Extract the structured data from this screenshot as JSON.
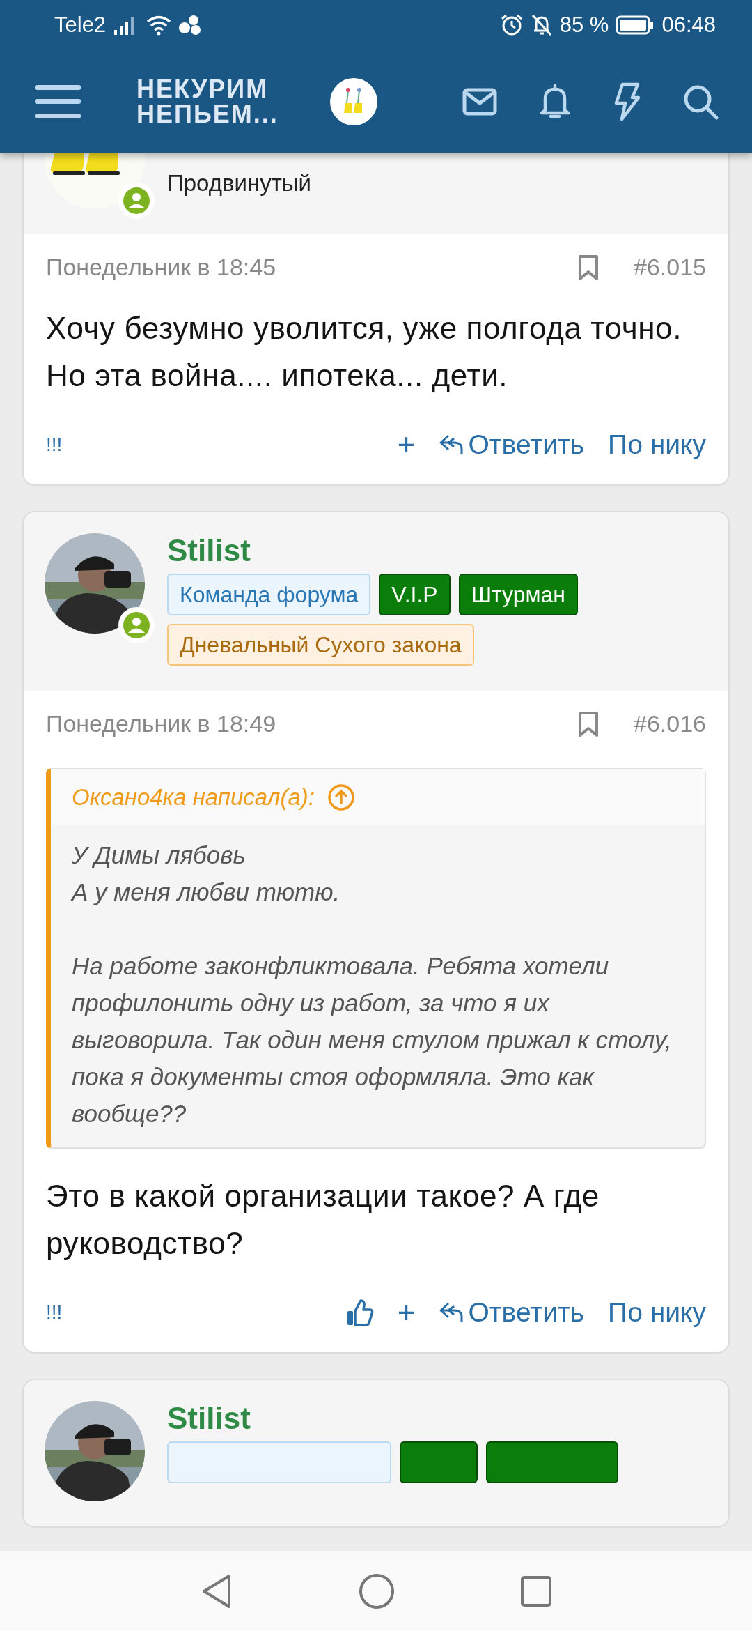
{
  "status_bar": {
    "carrier": "Tele2",
    "battery": "85 %",
    "time": "06:48"
  },
  "header": {
    "logo_lines": [
      "НЕКУРИМ",
      "НЕПЬЕМ..."
    ]
  },
  "posts": [
    {
      "user": {
        "online": true,
        "title": "Продвинутый"
      },
      "date": "Понедельник в 18:45",
      "number": "#6.015",
      "paragraphs": [
        "Хочу безумно уволится, уже полгода точно. Но эта война.... ипотека... дети."
      ],
      "actions": {
        "flag": "!!!",
        "like": false,
        "plus": "+",
        "reply": "Ответить",
        "by_nick": "По нику"
      }
    },
    {
      "user": {
        "online": true,
        "name": "Stilist",
        "badges": [
          {
            "kind": "team",
            "label": "Команда форума"
          },
          {
            "kind": "green",
            "label": "V.I.P"
          },
          {
            "kind": "green",
            "label": "Штурман"
          },
          {
            "kind": "orange",
            "label": "Дневальный Сухого закона"
          }
        ]
      },
      "date": "Понедельник в 18:49",
      "number": "#6.016",
      "quote": {
        "author": "Оксано4ка написал(а):",
        "paragraphs": [
          "У Димы лябовь\nА у меня любви тютю.",
          "На работе законфликтовала. Ребята хотели профилонить одну из работ, за что я их выговорила. Так один меня стулом прижал к столу, пока я документы стоя оформляла. Это как вообще??"
        ]
      },
      "paragraphs": [
        "Это в какой организации такое? А где руководство?"
      ],
      "actions": {
        "flag": "!!!",
        "like": true,
        "plus": "+",
        "reply": "Ответить",
        "by_nick": "По нику"
      }
    },
    {
      "user": {
        "name": "Stilist",
        "badges": [
          {
            "kind": "team"
          },
          {
            "kind": "green"
          },
          {
            "kind": "green"
          }
        ]
      }
    }
  ]
}
